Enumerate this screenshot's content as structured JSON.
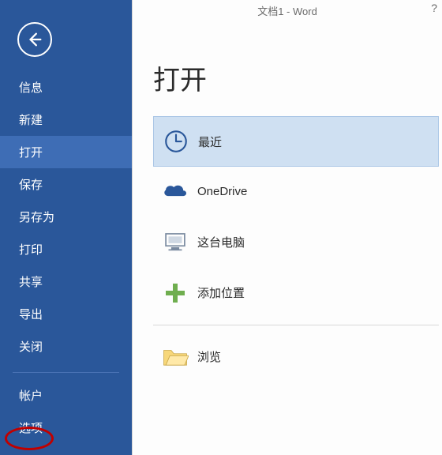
{
  "window": {
    "title": "文档1 - Word",
    "help": "?"
  },
  "sidebar": {
    "items": [
      {
        "label": "信息"
      },
      {
        "label": "新建"
      },
      {
        "label": "打开",
        "active": true
      },
      {
        "label": "保存"
      },
      {
        "label": "另存为"
      },
      {
        "label": "打印"
      },
      {
        "label": "共享"
      },
      {
        "label": "导出"
      },
      {
        "label": "关闭"
      }
    ],
    "footer": [
      {
        "label": "帐户"
      },
      {
        "label": "选项",
        "highlighted": true
      }
    ]
  },
  "page": {
    "heading": "打开"
  },
  "sources": [
    {
      "label": "最近",
      "icon": "clock-icon",
      "selected": true
    },
    {
      "label": "OneDrive",
      "icon": "onedrive-icon"
    },
    {
      "label": "这台电脑",
      "icon": "computer-icon"
    },
    {
      "label": "添加位置",
      "icon": "plus-icon"
    },
    {
      "label": "浏览",
      "icon": "folder-icon",
      "divider_before": true
    }
  ]
}
